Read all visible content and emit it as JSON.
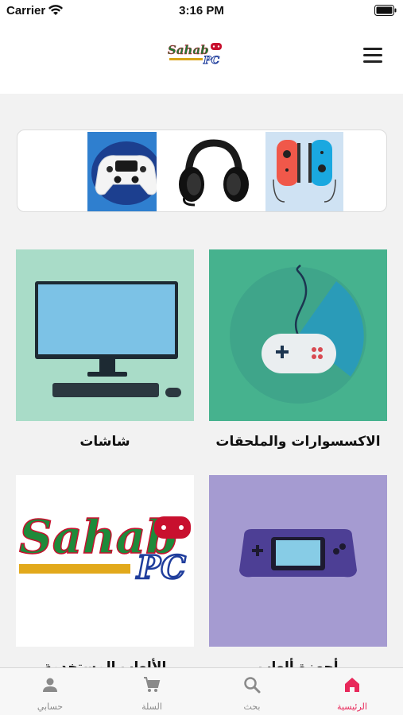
{
  "status_bar": {
    "carrier": "Carrier",
    "time": "3:16 PM"
  },
  "header": {
    "logo_alt": "Sahab PC",
    "menu_icon": "hamburger-menu-icon"
  },
  "banner": {
    "items": [
      "ps5-controller",
      "gaming-headset",
      "switch-joycons"
    ]
  },
  "categories": [
    {
      "label": "الاكسسوارات والملحقات",
      "image": "gamepad"
    },
    {
      "label": "شاشات",
      "image": "monitor"
    },
    {
      "label": "أجهزة ألعاب",
      "image": "handheld-console"
    },
    {
      "label": "الألعاب المستخدمة",
      "image": "sahab-logo"
    }
  ],
  "bottom_nav": {
    "items": [
      {
        "label": "الرئيسية",
        "icon": "home-icon",
        "active": true
      },
      {
        "label": "بحث",
        "icon": "search-icon",
        "active": false
      },
      {
        "label": "السلة",
        "icon": "cart-icon",
        "active": false
      },
      {
        "label": "حسابي",
        "icon": "person-icon",
        "active": false
      }
    ]
  },
  "colors": {
    "accent": "#e8285a",
    "teal": "#46b28e",
    "mint": "#a9dcc8",
    "lavender": "#a59bd1"
  }
}
